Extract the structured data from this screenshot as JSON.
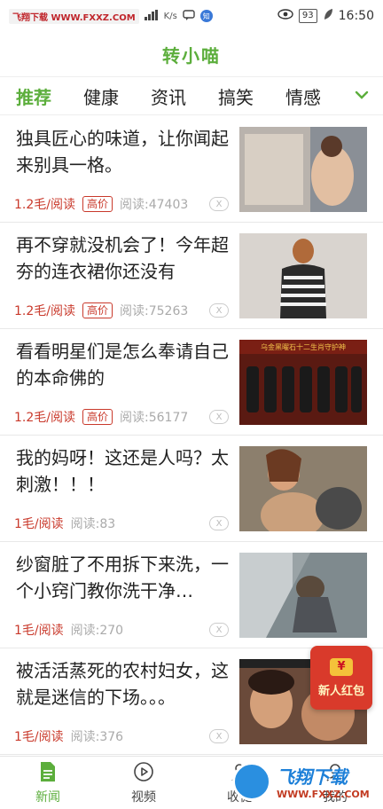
{
  "status_bar": {
    "watermark": "飞翔下载 WWW.FXXZ.COM",
    "speed": "K/s",
    "app_dot": "知",
    "battery": "93",
    "time": "16:50"
  },
  "app": {
    "title": "转小喵"
  },
  "tabs": [
    {
      "label": "推荐",
      "active": true
    },
    {
      "label": "健康"
    },
    {
      "label": "资讯"
    },
    {
      "label": "搞笑"
    },
    {
      "label": "情感"
    }
  ],
  "news": [
    {
      "title": "独具匠心的味道，让你闻起来别具一格。",
      "reward": "1.2毛/阅读",
      "badge": "高价",
      "reads": "阅读:47403",
      "dismiss": "X"
    },
    {
      "title": "再不穿就没机会了！今年超夯的连衣裙你还没有",
      "reward": "1.2毛/阅读",
      "badge": "高价",
      "reads": "阅读:75263",
      "dismiss": "X"
    },
    {
      "title": "看看明星们是怎么奉请自己的本命佛的",
      "reward": "1.2毛/阅读",
      "badge": "高价",
      "reads": "阅读:56177",
      "dismiss": "X",
      "thumb_caption": "乌金黑曜石十二生肖守护神"
    },
    {
      "title": "我的妈呀！这还是人吗？太刺激！！！",
      "reward": "1毛/阅读",
      "reads": "阅读:83",
      "dismiss": "X"
    },
    {
      "title": "纱窗脏了不用拆下来洗，一个小窍门教你洗干净…",
      "reward": "1毛/阅读",
      "reads": "阅读:270",
      "dismiss": "X"
    },
    {
      "title": "被活活蒸死的农村妇女，这就是迷信的下场。。。",
      "reward": "1毛/阅读",
      "reads": "阅读:376",
      "dismiss": "X"
    }
  ],
  "red_packet": {
    "coin": "¥",
    "label": "新人红包"
  },
  "bottom_nav": [
    {
      "label": "新闻",
      "icon": "news-doc-icon",
      "active": true
    },
    {
      "label": "视频",
      "icon": "play-circle-icon"
    },
    {
      "label": "收徒",
      "icon": "apprentice-icon"
    },
    {
      "label": "我的",
      "icon": "profile-icon"
    }
  ],
  "watermark": {
    "main": "飞翔下载",
    "sub": "WWW.FXXZ.COM"
  },
  "colors": {
    "accent": "#5cae3c",
    "reward": "#c9392b",
    "red_packet": "#d93a2b"
  }
}
